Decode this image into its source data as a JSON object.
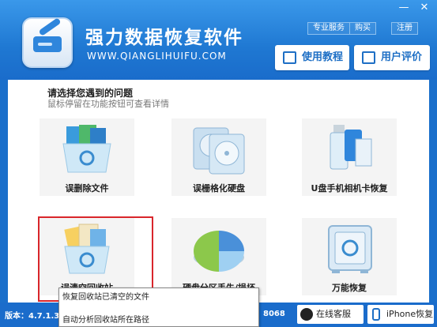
{
  "app": {
    "title": "强力数据恢复软件",
    "subtitle": "WWW.QIANGLIHUIFU.COM"
  },
  "window": {
    "minimize": "—",
    "close": "✕"
  },
  "top_links": [
    "专业服务",
    "购买",
    "注册"
  ],
  "header_buttons": [
    {
      "label": "使用教程"
    },
    {
      "label": "用户评价"
    }
  ],
  "content": {
    "heading": "请选择您遇到的问题",
    "hint": "鼠标停留在功能按钮可查看详情"
  },
  "tiles": [
    {
      "label": "误删除文件",
      "icon": "recycle-files-icon"
    },
    {
      "label": "误栅格化硬盘",
      "icon": "hard-disk-icon"
    },
    {
      "label": "U盘手机相机卡恢复",
      "icon": "usb-phone-card-icon"
    },
    {
      "label": "误清空回收站",
      "icon": "recycle-bin-icon"
    },
    {
      "label": "硬盘分区丢失/损坏",
      "icon": "partition-pie-icon"
    },
    {
      "label": "万能恢复",
      "icon": "safe-box-icon"
    }
  ],
  "tooltip": {
    "line1": "恢复回收站已清空的文件",
    "line2": "自动分析回收站所在路径"
  },
  "footer": {
    "version": "版本：4.7.1.3",
    "phone": "8068",
    "online_service": "在线客服",
    "iphone": "iPhone恢复"
  },
  "colors": {
    "accent": "#1f78d2",
    "selection": "#d9262b"
  }
}
